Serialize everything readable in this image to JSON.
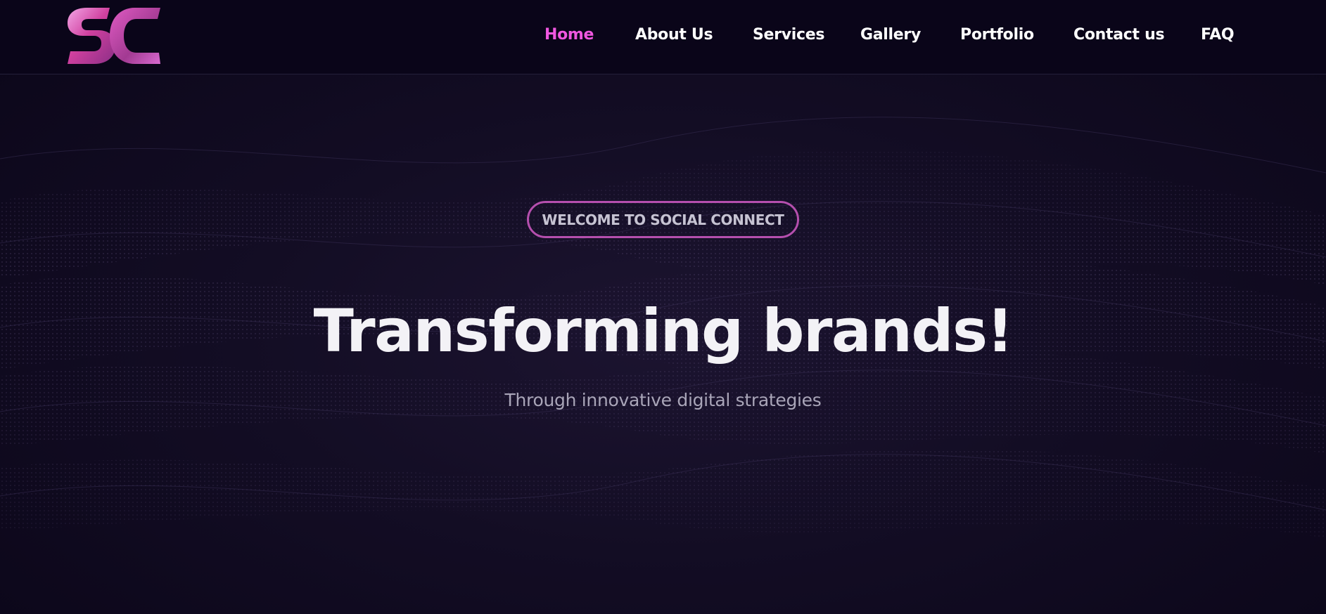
{
  "header": {
    "logo_text": "SC",
    "nav": [
      {
        "label": "Home",
        "active": true
      },
      {
        "label": "About Us",
        "active": false
      },
      {
        "label": "Services",
        "active": false
      },
      {
        "label": "Gallery",
        "active": false
      },
      {
        "label": "Portfolio",
        "active": false
      },
      {
        "label": "Contact us",
        "active": false
      },
      {
        "label": "FAQ",
        "active": false
      }
    ]
  },
  "hero": {
    "badge": "WELCOME TO SOCIAL CONNECT",
    "headline": "Transforming brands!",
    "subline": "Through innovative digital strategies"
  },
  "colors": {
    "background": "#0b0619",
    "accent": "#f057e0",
    "badge_border": "#b54fae",
    "nav_text": "#ffffff"
  }
}
